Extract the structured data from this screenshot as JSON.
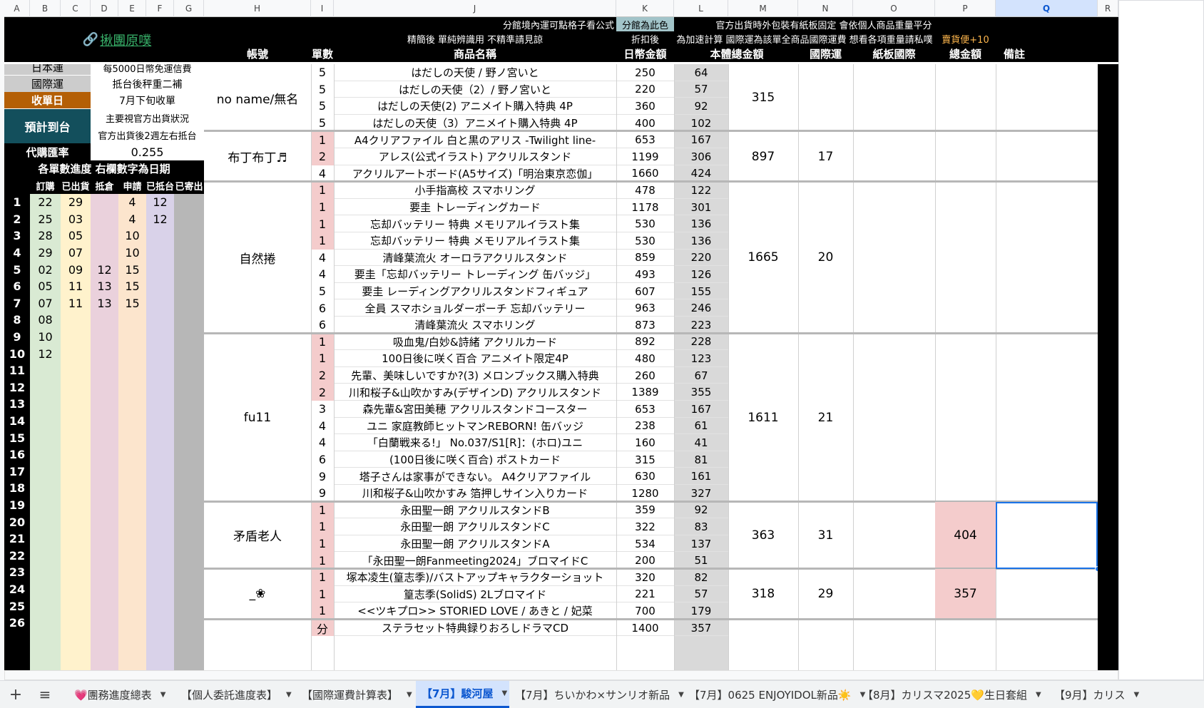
{
  "columns": [
    "A",
    "B",
    "C",
    "D",
    "E",
    "F",
    "G",
    "H",
    "I",
    "J",
    "K",
    "L",
    "M",
    "N",
    "O",
    "P",
    "Q",
    "R"
  ],
  "header": {
    "link_icon": "🔗",
    "link": "揪團原噗",
    "j1": "分館境內運可點格子看公式",
    "k1": "分館為此色",
    "lm1": "官方出貨時外包裝有紙板固定 會依個人商品重量平分",
    "j2": "精簡後 單純辨識用 不精準請見諒",
    "k2": "折扣後",
    "lm2": "為加速計算 國際運為該單全商品國際運費 想看各項重量請私噗",
    "p2": "賣貨便+10",
    "h3": "帳號",
    "i3": "單數",
    "j3": "商品名稱",
    "k3": "日幣金額",
    "l3": "本體總金額",
    "n3": "國際運",
    "o3": "紙板國際",
    "p3": "總金額",
    "q3": "備註"
  },
  "left_info": {
    "r1_label": "日本運",
    "r1_val": "每5000日幣免運信費",
    "r2_label": "國際運",
    "r2_val": "抵台後秤重二補",
    "r3_label": "收單日",
    "r3_val": "7月下旬收單",
    "r4_label": "預計到台",
    "r4_val1": "主要視官方出貨狀況",
    "r4_val2": "官方出貨後2週左右抵台",
    "rate_label": "代購匯率",
    "rate_val": "0.255",
    "progress_title": "各單數進度 右欄數字為日期",
    "prog_headers": [
      "訂購",
      "已出貨",
      "抵倉",
      "申請",
      "已抵台",
      "已寄出"
    ]
  },
  "progress_rows": [
    [
      "22",
      "29",
      "",
      "4",
      "12",
      ""
    ],
    [
      "25",
      "03",
      "",
      "4",
      "12",
      ""
    ],
    [
      "28",
      "05",
      "",
      "10",
      "",
      ""
    ],
    [
      "29",
      "07",
      "",
      "10",
      "",
      ""
    ],
    [
      "02",
      "09",
      "12",
      "15",
      "",
      ""
    ],
    [
      "05",
      "11",
      "13",
      "15",
      "",
      ""
    ],
    [
      "07",
      "11",
      "13",
      "15",
      "",
      ""
    ],
    [
      "08",
      "",
      "",
      "",
      "",
      ""
    ],
    [
      "10",
      "",
      "",
      "",
      "",
      ""
    ],
    [
      "12",
      "",
      "",
      "",
      "",
      ""
    ],
    [
      "",
      "",
      "",
      "",
      "",
      ""
    ],
    [
      "",
      "",
      "",
      "",
      "",
      ""
    ],
    [
      "",
      "",
      "",
      "",
      "",
      ""
    ],
    [
      "",
      "",
      "",
      "",
      "",
      ""
    ],
    [
      "",
      "",
      "",
      "",
      "",
      ""
    ],
    [
      "",
      "",
      "",
      "",
      "",
      ""
    ],
    [
      "",
      "",
      "",
      "",
      "",
      ""
    ],
    [
      "",
      "",
      "",
      "",
      "",
      ""
    ],
    [
      "",
      "",
      "",
      "",
      "",
      ""
    ],
    [
      "",
      "",
      "",
      "",
      "",
      ""
    ],
    [
      "",
      "",
      "",
      "",
      "",
      ""
    ],
    [
      "",
      "",
      "",
      "",
      "",
      ""
    ],
    [
      "",
      "",
      "",
      "",
      "",
      ""
    ],
    [
      "",
      "",
      "",
      "",
      "",
      ""
    ],
    [
      "",
      "",
      "",
      "",
      "",
      ""
    ]
  ],
  "row_numbers": [
    "1",
    "2",
    "3",
    "4",
    "5",
    "6",
    "7",
    "8",
    "9",
    "10",
    "11",
    "12",
    "13",
    "14",
    "15",
    "16",
    "17",
    "18",
    "19",
    "20",
    "21",
    "22",
    "23",
    "24",
    "25",
    "26"
  ],
  "orders": [
    [
      "5",
      "はだしの天使 / 野ノ宮いと",
      "250",
      "64"
    ],
    [
      "5",
      "はだしの天使（2）/ 野ノ宮いと",
      "220",
      "57"
    ],
    [
      "5",
      "はだしの天使(2) アニメイト購入特典 4P",
      "360",
      "92"
    ],
    [
      "5",
      "はだしの天使（3）アニメイト購入特典 4P",
      "400",
      "102"
    ],
    [
      "1",
      "A4クリアファイル 白と黒のアリス -Twilight line-",
      "653",
      "167"
    ],
    [
      "2",
      "アレス(公式イラスト) アクリルスタンド",
      "1199",
      "306"
    ],
    [
      "4",
      "アクリルアートボード(A5サイズ)「明治東京恋伽」",
      "1660",
      "424"
    ],
    [
      "1",
      "小手指高校 スマホリング",
      "478",
      "122"
    ],
    [
      "1",
      "要圭 トレーディングカード",
      "1178",
      "301"
    ],
    [
      "1",
      "忘却バッテリー 特典 メモリアルイラスト集",
      "530",
      "136"
    ],
    [
      "1",
      "忘却バッテリー 特典 メモリアルイラスト集",
      "530",
      "136"
    ],
    [
      "4",
      "清峰葉流火 オーロラアクリルスタンド",
      "859",
      "220"
    ],
    [
      "4",
      "要圭「忘却バッテリー トレーディング 缶バッジ」",
      "493",
      "126"
    ],
    [
      "5",
      "要圭 レーディングアクリルスタンドフィギュア",
      "607",
      "155"
    ],
    [
      "6",
      "全員 スマホショルダーポーチ 忘却バッテリー",
      "963",
      "246"
    ],
    [
      "6",
      "清峰葉流火 スマホリング",
      "873",
      "223"
    ],
    [
      "1",
      "吸血鬼/白妙&詩緒 アクリルカード",
      "892",
      "228"
    ],
    [
      "1",
      "100日後に咲く百合 アニメイト限定4P",
      "480",
      "123"
    ],
    [
      "2",
      "先輩、美味しいですか?(3) メロンブックス購入特典",
      "260",
      "67"
    ],
    [
      "2",
      "川和桜子&山吹かすみ(デザインD) アクリルスタンド",
      "1389",
      "355"
    ],
    [
      "3",
      "森先輩&宮田美穂 アクリルスタンドコースター",
      "653",
      "167"
    ],
    [
      "4",
      "ユニ 家庭教師ヒットマンREBORN! 缶バッジ",
      "238",
      "61"
    ],
    [
      "4",
      "「白蘭戦来る!」 No.037/S1[R]：(ホロ)ユニ",
      "160",
      "41"
    ],
    [
      "6",
      "(100日後に咲く百合) ポストカード",
      "315",
      "81"
    ],
    [
      "9",
      "塔子さんは家事ができない。 A4クリアファイル",
      "630",
      "161"
    ],
    [
      "9",
      "川和桜子&山吹かすみ 箔押しサイン入りカード",
      "1280",
      "327"
    ],
    [
      "1",
      "永田聖一朗 アクリルスタンドB",
      "359",
      "92"
    ],
    [
      "1",
      "永田聖一朗 アクリルスタンドC",
      "322",
      "83"
    ],
    [
      "1",
      "永田聖一朗 アクリルスタンドA",
      "534",
      "137"
    ],
    [
      "1",
      "「永田聖一朗Fanmeeting2024」ブロマイドC",
      "200",
      "51"
    ],
    [
      "1",
      "塚本凌生(篁志季)/バストアップキャラクターショット",
      "320",
      "82"
    ],
    [
      "1",
      "篁志季(SolidS) 2Lブロマイド",
      "221",
      "57"
    ],
    [
      "1",
      "<<ツキプロ>> STORIED LOVE / あきと / 妃菜",
      "700",
      "179"
    ],
    [
      "分",
      "ステラセット特典録りおろしドラマCD",
      "1400",
      "357"
    ]
  ],
  "groups": [
    {
      "name": "no name/無名",
      "total": "315",
      "intl": "",
      "final": ""
    },
    {
      "name": "布丁布丁♬",
      "total": "897",
      "intl": "17",
      "final": ""
    },
    {
      "name": "自然捲",
      "total": "1665",
      "intl": "20",
      "final": ""
    },
    {
      "name": "fu11",
      "total": "1611",
      "intl": "21",
      "final": ""
    },
    {
      "name": "矛盾老人",
      "total": "363",
      "intl": "31",
      "final": "404"
    },
    {
      "name": "_❀",
      "total": "318",
      "intl": "29",
      "final": "357"
    }
  ],
  "tabs": [
    {
      "label": "💗團務進度總表"
    },
    {
      "label": "【個人委託進度表】"
    },
    {
      "label": "【國際運費計算表】"
    },
    {
      "label": "【7月】駿河屋"
    },
    {
      "label": "【7月】ちいかわ×サンリオ新品"
    },
    {
      "label": "【7月】0625 ENJOYIDOL新品☀️"
    },
    {
      "label": "【8月】カリスマ2025💛生日套組"
    },
    {
      "label": "【9月】カリス"
    }
  ],
  "sheet_controls": {
    "add": "+",
    "menu": "≡"
  },
  "colors": {
    "black": "#000000",
    "pink": "#f4cccc",
    "yellow": "#fff2cc",
    "green": "#d9ead3",
    "purple": "#d9d2e9",
    "peach": "#fce5cd",
    "gray": "#b7b7b7",
    "teal": "#134f5c",
    "brown": "#b45f06",
    "accent": "#1a73e8"
  }
}
